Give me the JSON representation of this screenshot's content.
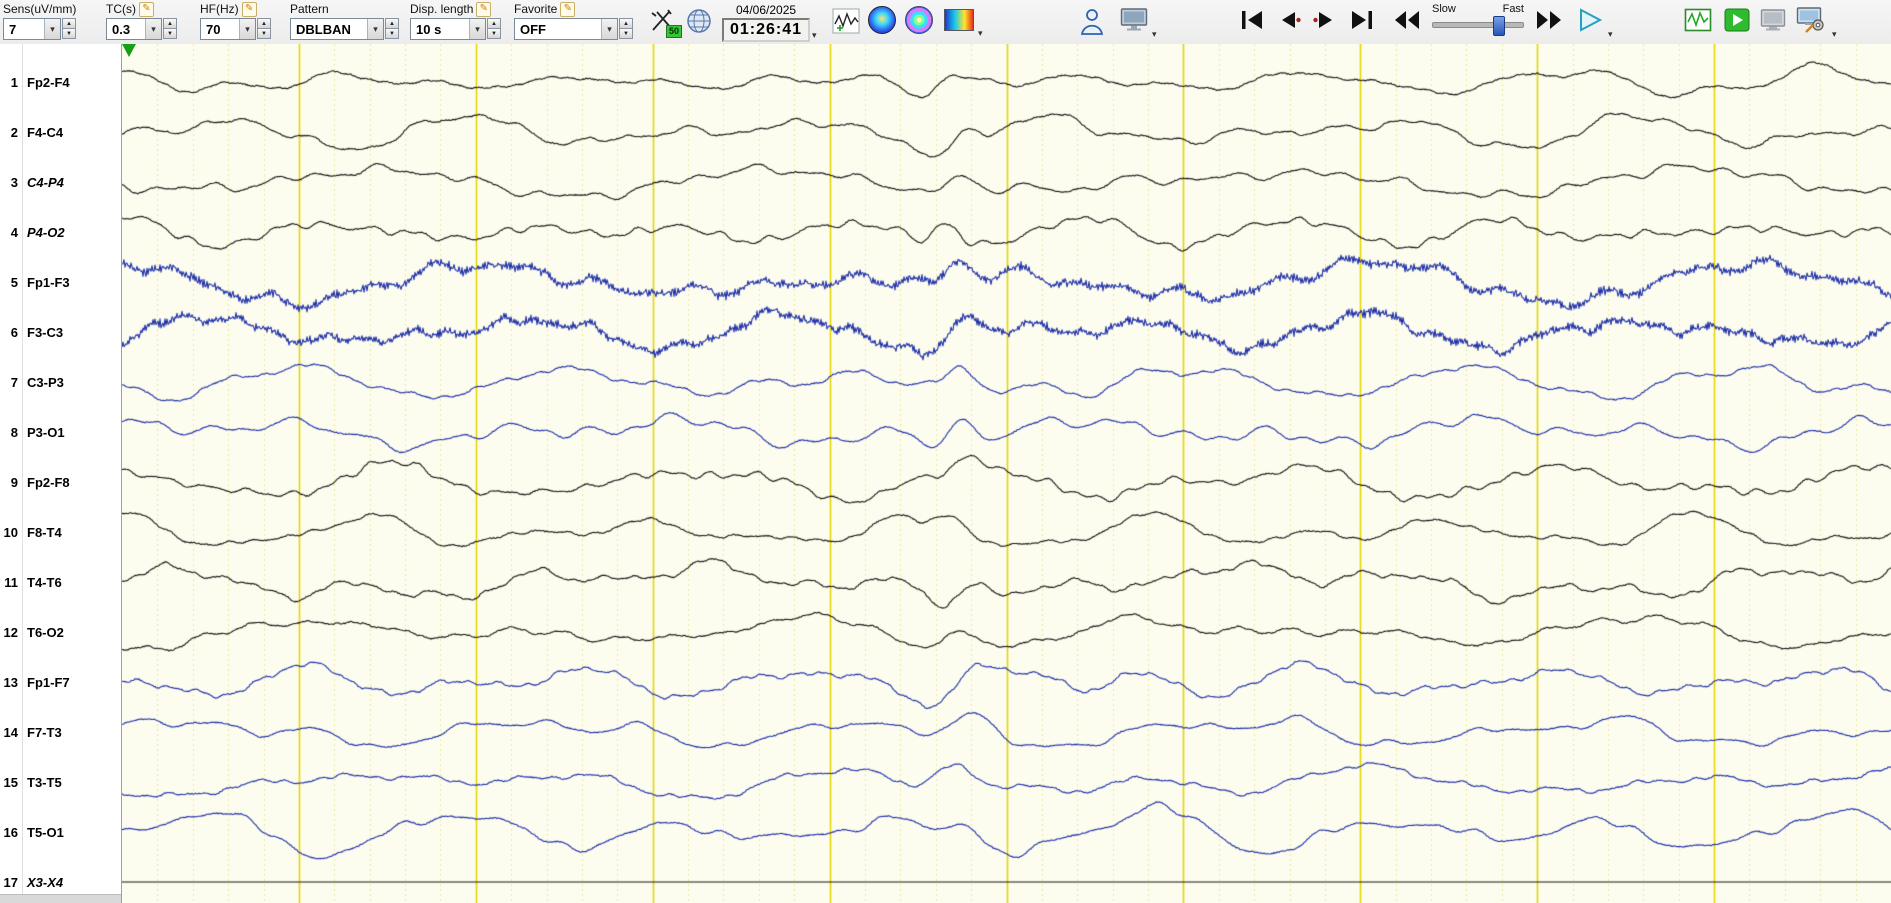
{
  "toolbar": {
    "sens": {
      "label": "Sens(uV/mm)",
      "value": "7"
    },
    "tc": {
      "label": "TC(s)",
      "value": "0.3"
    },
    "hf": {
      "label": "HF(Hz)",
      "value": "70"
    },
    "pattern": {
      "label": "Pattern",
      "value": "DBLBAN"
    },
    "disp_length": {
      "label": "Disp. length",
      "value": "10 s"
    },
    "favorite": {
      "label": "Favorite",
      "value": "OFF"
    },
    "measure_badge": "50",
    "datetime": {
      "date": "04/06/2025",
      "time": "01:26:41"
    },
    "speed": {
      "slow": "Slow",
      "fast": "Fast",
      "thumb_pos": 0.72
    },
    "icons": [
      "measure-tool",
      "montage-globe",
      "waveform-graph",
      "brain-map",
      "color-map",
      "spectrogram",
      "patient-info",
      "video-monitor",
      "skip-start",
      "step-back",
      "step-forward",
      "skip-end",
      "rewind",
      "fast-forward",
      "play",
      "live-eeg",
      "live-play",
      "prev-screen",
      "system-settings"
    ]
  },
  "eeg": {
    "channels": [
      {
        "num": "1",
        "label": "Fp2-F4",
        "color": "#151515",
        "italic": false,
        "profile": "normal"
      },
      {
        "num": "2",
        "label": "F4-C4",
        "color": "#151515",
        "italic": false,
        "profile": "normal"
      },
      {
        "num": "3",
        "label": "C4-P4",
        "color": "#151515",
        "italic": true,
        "profile": "normal"
      },
      {
        "num": "4",
        "label": "P4-O2",
        "color": "#151515",
        "italic": true,
        "profile": "normal"
      },
      {
        "num": "5",
        "label": "Fp1-F3",
        "color": "#1e2fa8",
        "italic": false,
        "profile": "noisy"
      },
      {
        "num": "6",
        "label": "F3-C3",
        "color": "#1e2fa8",
        "italic": false,
        "profile": "noisy"
      },
      {
        "num": "7",
        "label": "C3-P3",
        "color": "#1e2fa8",
        "italic": false,
        "profile": "normal"
      },
      {
        "num": "8",
        "label": "P3-O1",
        "color": "#1e2fa8",
        "italic": false,
        "profile": "normal"
      },
      {
        "num": "9",
        "label": "Fp2-F8",
        "color": "#151515",
        "italic": false,
        "profile": "normal"
      },
      {
        "num": "10",
        "label": "F8-T4",
        "color": "#151515",
        "italic": false,
        "profile": "normal"
      },
      {
        "num": "11",
        "label": "T4-T6",
        "color": "#151515",
        "italic": false,
        "profile": "normal"
      },
      {
        "num": "12",
        "label": "T6-O2",
        "color": "#151515",
        "italic": false,
        "profile": "normal"
      },
      {
        "num": "13",
        "label": "Fp1-F7",
        "color": "#1e2fa8",
        "italic": false,
        "profile": "normal"
      },
      {
        "num": "14",
        "label": "F7-T3",
        "color": "#1e2fa8",
        "italic": false,
        "profile": "normal"
      },
      {
        "num": "15",
        "label": "T3-T5",
        "color": "#1e2fa8",
        "italic": false,
        "profile": "normal"
      },
      {
        "num": "16",
        "label": "T5-O1",
        "color": "#1e2fa8",
        "italic": false,
        "profile": "normal"
      },
      {
        "num": "17",
        "label": "X3-X4",
        "color": "#151515",
        "italic": true,
        "profile": "flat"
      }
    ],
    "grid": {
      "seconds": 10,
      "minor_per_major": 5,
      "bg": "#fdfdef",
      "major_color": "#e6d600",
      "minor_color": "#eee89c"
    }
  }
}
